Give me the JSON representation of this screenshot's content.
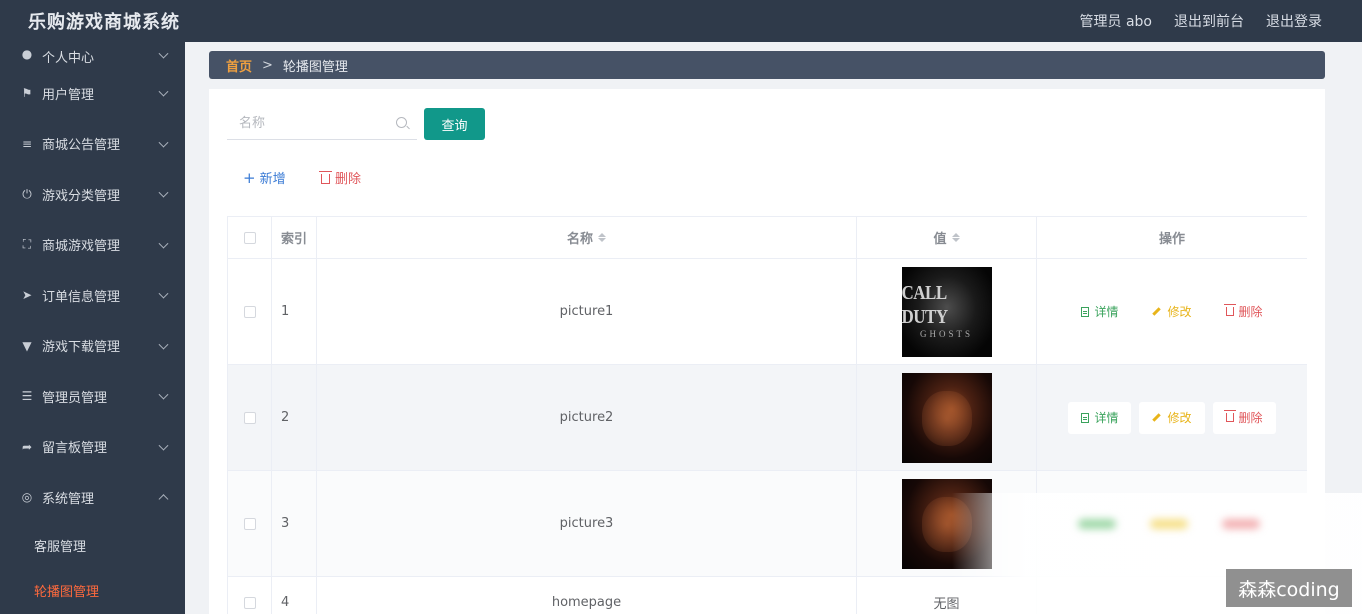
{
  "header": {
    "title": "乐购游戏商城系统",
    "admin": "管理员 abo",
    "to_front": "退出到前台",
    "logout": "退出登录"
  },
  "sidebar": {
    "items": [
      {
        "label": "个人中心",
        "icon": "user-icon"
      },
      {
        "label": "用户管理",
        "icon": "flag-icon"
      },
      {
        "label": "商城公告管理",
        "icon": "list-icon"
      },
      {
        "label": "游戏分类管理",
        "icon": "power-icon"
      },
      {
        "label": "商城游戏管理",
        "icon": "frame-icon"
      },
      {
        "label": "订单信息管理",
        "icon": "send-icon"
      },
      {
        "label": "游戏下载管理",
        "icon": "download-icon"
      },
      {
        "label": "管理员管理",
        "icon": "menu-icon"
      },
      {
        "label": "留言板管理",
        "icon": "navigation-icon"
      },
      {
        "label": "系统管理",
        "icon": "microphone-icon"
      }
    ],
    "sub_items": [
      {
        "label": "客服管理"
      },
      {
        "label": "轮播图管理"
      }
    ]
  },
  "breadcrumb": {
    "home": "首页",
    "separator": ">",
    "current": "轮播图管理"
  },
  "search": {
    "placeholder": "名称",
    "query_label": "查询"
  },
  "toolbar": {
    "add_label": "新增",
    "delete_label": "删除"
  },
  "table": {
    "headers": {
      "index": "索引",
      "name": "名称",
      "value": "值",
      "actions": "操作"
    },
    "rows": [
      {
        "index": "1",
        "name": "picture1",
        "value_image": "call-of-duty-ghosts-image",
        "image_text_1": "CALL DUTY",
        "image_text_2": "GHOSTS"
      },
      {
        "index": "2",
        "name": "picture2",
        "value_image": "fire-artwork-image"
      },
      {
        "index": "3",
        "name": "picture3",
        "value_image": "fire-artwork-image"
      },
      {
        "index": "4",
        "name": "homepage",
        "value_text": "无图"
      }
    ],
    "actions": {
      "detail": "详情",
      "edit": "修改",
      "delete": "删除"
    }
  },
  "watermark": "森森coding",
  "colors": {
    "header_bg": "#2f3a4a",
    "sidebar_bg": "#2f3a4a",
    "breadcrumb_bg": "#465266",
    "primary": "#11988a",
    "active_menu": "#ff6a3d",
    "detail": "#3aa35c",
    "edit": "#e8b41a",
    "danger": "#e0565a"
  }
}
